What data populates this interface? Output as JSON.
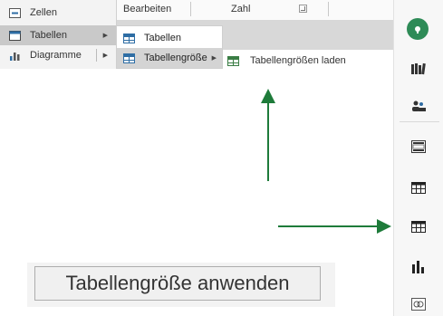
{
  "ribbon": {
    "bearbeiten": "Bearbeiten",
    "zahl": "Zahl"
  },
  "menu1": {
    "items": [
      {
        "label": "Zellen",
        "icon": "cells-icon"
      },
      {
        "label": "Tabellen",
        "icon": "table-icon"
      },
      {
        "label": "Diagramme",
        "icon": "bar-chart-icon"
      }
    ]
  },
  "menu2": {
    "items": [
      {
        "label": "Tabellen",
        "icon": "table-icon"
      },
      {
        "label": "Tabellengröße",
        "icon": "table-size-icon"
      }
    ]
  },
  "menu3": {
    "label": "Tabellengrößen laden",
    "icon": "table-size-load-icon"
  },
  "sidebar": {
    "icons": [
      "add-green-icon",
      "books-icon",
      "people-icon",
      "frame-icon",
      "table-icon",
      "table-icon",
      "bar-chart-icon",
      "link-icon"
    ]
  },
  "apply_button": {
    "label": "Tabellengröße anwenden"
  },
  "colors": {
    "arrow": "#1e7b3a",
    "accent_green": "#2e8b57",
    "table_blue": "#2e6da4"
  }
}
